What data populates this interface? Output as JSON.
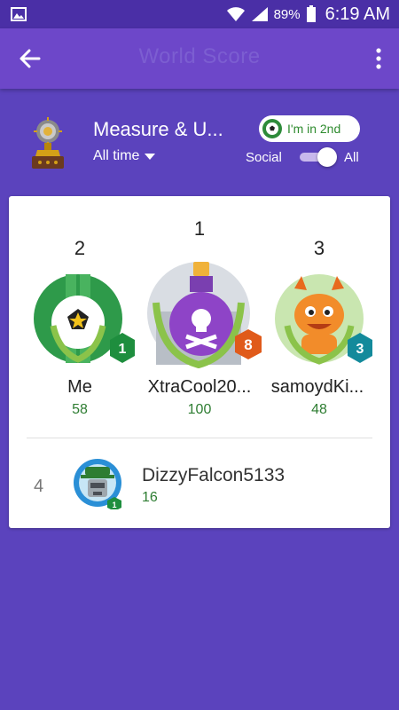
{
  "status_bar": {
    "battery_percent": "89%",
    "time": "6:19 AM"
  },
  "app_bar": {
    "title": "World Score"
  },
  "header": {
    "leaderboard_title": "Measure & U...",
    "timeframe": "All time",
    "rank_chip": "I'm in 2nd",
    "social_label": "Social",
    "all_label": "All",
    "toggle_state": "All"
  },
  "podium": [
    {
      "rank": "2",
      "name": "Me",
      "score": "58",
      "level": "1",
      "avatar": "soccer-ball",
      "badge_color": "#1e8e3e"
    },
    {
      "rank": "1",
      "name": "XtraCool20...",
      "score": "100",
      "level": "8",
      "avatar": "poison-potion",
      "badge_color": "#e05a1a"
    },
    {
      "rank": "3",
      "name": "samoydKi...",
      "score": "48",
      "level": "3",
      "avatar": "orange-dragon",
      "badge_color": "#138a9b"
    }
  ],
  "list": [
    {
      "rank": "4",
      "name": "DizzyFalcon5133",
      "score": "16",
      "level": "1",
      "avatar": "robot-hat"
    }
  ],
  "colors": {
    "background": "#5b43bd",
    "app_bar": "#6d47c9",
    "score_green": "#2e7d32"
  }
}
